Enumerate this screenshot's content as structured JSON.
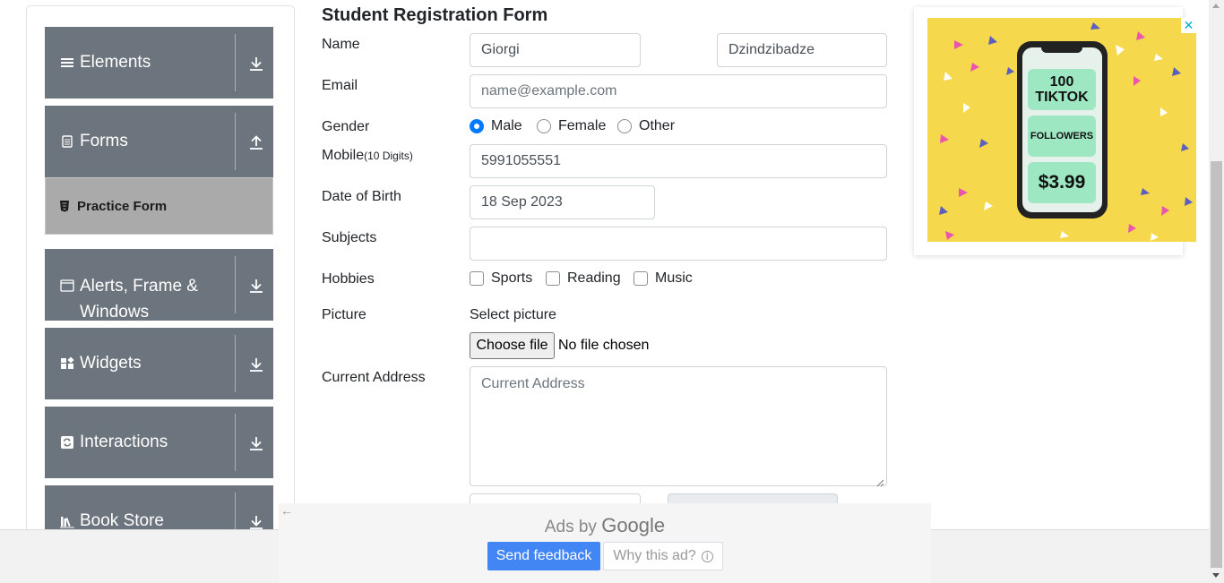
{
  "sidebar": {
    "groups": [
      {
        "label": "Elements",
        "icon": "hamburger-icon",
        "arrow": "download"
      },
      {
        "label": "Forms",
        "icon": "document-icon",
        "arrow": "upload"
      },
      {
        "label": "Alerts, Frame & Windows",
        "icon": "window-icon",
        "arrow": "download"
      },
      {
        "label": "Widgets",
        "icon": "widgets-icon",
        "arrow": "download"
      },
      {
        "label": "Interactions",
        "icon": "refresh-icon",
        "arrow": "download"
      },
      {
        "label": "Book Store",
        "icon": "books-icon",
        "arrow": "download"
      }
    ],
    "active_item": "Practice Form"
  },
  "form": {
    "title": "Student Registration Form",
    "labels": {
      "name": "Name",
      "email": "Email",
      "gender": "Gender",
      "mobile": "Mobile",
      "mobile_hint": "(10 Digits)",
      "dob": "Date of Birth",
      "subjects": "Subjects",
      "hobbies": "Hobbies",
      "picture": "Picture",
      "address": "Current Address"
    },
    "first_name": "Giorgi",
    "last_name": "Dzindzibadze",
    "email_placeholder": "name@example.com",
    "gender_options": [
      {
        "label": "Male",
        "selected": true
      },
      {
        "label": "Female",
        "selected": false
      },
      {
        "label": "Other",
        "selected": false
      }
    ],
    "mobile": "5991055551",
    "dob": "18 Sep 2023",
    "subjects": "",
    "hobbies": [
      {
        "label": "Sports",
        "checked": false
      },
      {
        "label": "Reading",
        "checked": false
      },
      {
        "label": "Music",
        "checked": false
      }
    ],
    "picture_prompt": "Select picture",
    "file_button": "Choose file",
    "file_status": "No file chosen",
    "address_placeholder": "Current Address"
  },
  "ad_right": {
    "close": "✕",
    "line1": "100 TIKTOK",
    "line2": "FOLLOWERS",
    "price": "$3.99",
    "accent": "#f6d84d"
  },
  "ad_bottom": {
    "ads_by": "Ads by",
    "google": "Google",
    "send_feedback": "Send feedback",
    "why_this_ad": "Why this ad?"
  }
}
